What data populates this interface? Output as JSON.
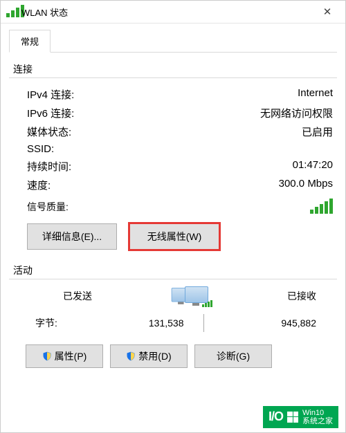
{
  "window": {
    "title": "WLAN 状态",
    "close": "✕"
  },
  "tabs": {
    "general": "常规"
  },
  "sections": {
    "connection": "连接",
    "activity": "活动"
  },
  "conn": {
    "ipv4_label": "IPv4 连接:",
    "ipv4_value": "Internet",
    "ipv6_label": "IPv6 连接:",
    "ipv6_value": "无网络访问权限",
    "media_label": "媒体状态:",
    "media_value": "已启用",
    "ssid_label": "SSID:",
    "ssid_value": "",
    "duration_label": "持续时间:",
    "duration_value": "01:47:20",
    "speed_label": "速度:",
    "speed_value": "300.0 Mbps",
    "signal_label": "信号质量:"
  },
  "buttons": {
    "details": "详细信息(E)...",
    "wireless_props": "无线属性(W)",
    "properties": "属性(P)",
    "disable": "禁用(D)",
    "diagnose": "诊断(G)"
  },
  "activity": {
    "sent_label": "已发送",
    "received_label": "已接收",
    "bytes_label": "字节:",
    "sent_value": "131,538",
    "received_value": "945,882"
  },
  "watermark": {
    "brand": "I/O",
    "line1": "Win10",
    "line2": "系统之家"
  }
}
